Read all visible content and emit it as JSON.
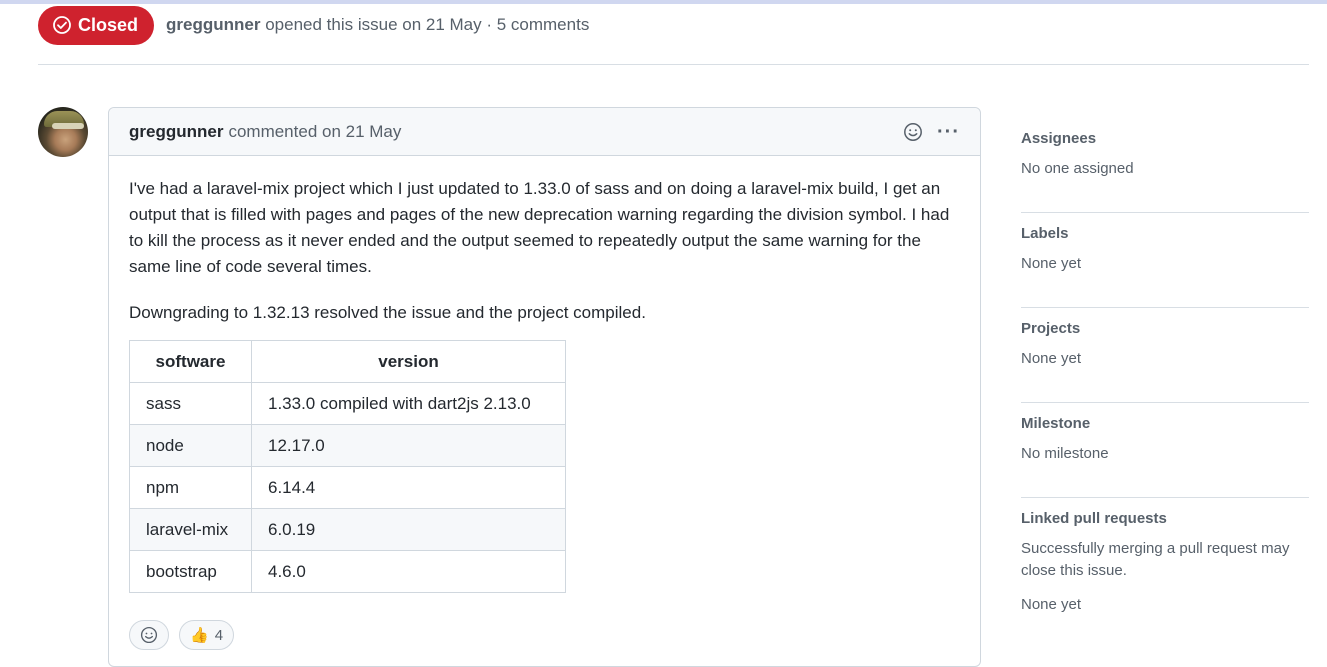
{
  "header": {
    "state": "Closed",
    "author": "greggunner",
    "meta": "opened this issue on 21 May · 5 comments"
  },
  "comment": {
    "author": "greggunner",
    "action": "commented on 21 May",
    "paragraph1": "I've had a laravel-mix project which I just updated to 1.33.0 of sass and on doing a laravel-mix build, I get an output that is filled with pages and pages of the new deprecation warning regarding the division symbol. I had to kill the process as it never ended and the output seemed to repeatedly output the same warning for the same line of code several times.",
    "paragraph2": "Downgrading to 1.32.13 resolved the issue and the project compiled.",
    "table": {
      "headers": [
        "software",
        "version"
      ],
      "rows": [
        [
          "sass",
          "1.33.0 compiled with dart2js 2.13.0"
        ],
        [
          "node",
          "12.17.0"
        ],
        [
          "npm",
          "6.14.4"
        ],
        [
          "laravel-mix",
          "6.0.19"
        ],
        [
          "bootstrap",
          "4.6.0"
        ]
      ]
    },
    "reactions": [
      {
        "icon": "smile-icon",
        "count": ""
      },
      {
        "icon": "thumbs-up",
        "emoji": "👍",
        "count": "4"
      }
    ]
  },
  "sidebar": {
    "assignees": {
      "title": "Assignees",
      "value": "No one assigned"
    },
    "labels": {
      "title": "Labels",
      "value": "None yet"
    },
    "projects": {
      "title": "Projects",
      "value": "None yet"
    },
    "milestone": {
      "title": "Milestone",
      "value": "No milestone"
    },
    "linked": {
      "title": "Linked pull requests",
      "note": "Successfully merging a pull request may close this issue.",
      "value": "None yet"
    }
  },
  "colors": {
    "closed": "#cf222e",
    "muted": "#57606a",
    "border": "#d0d7de"
  }
}
